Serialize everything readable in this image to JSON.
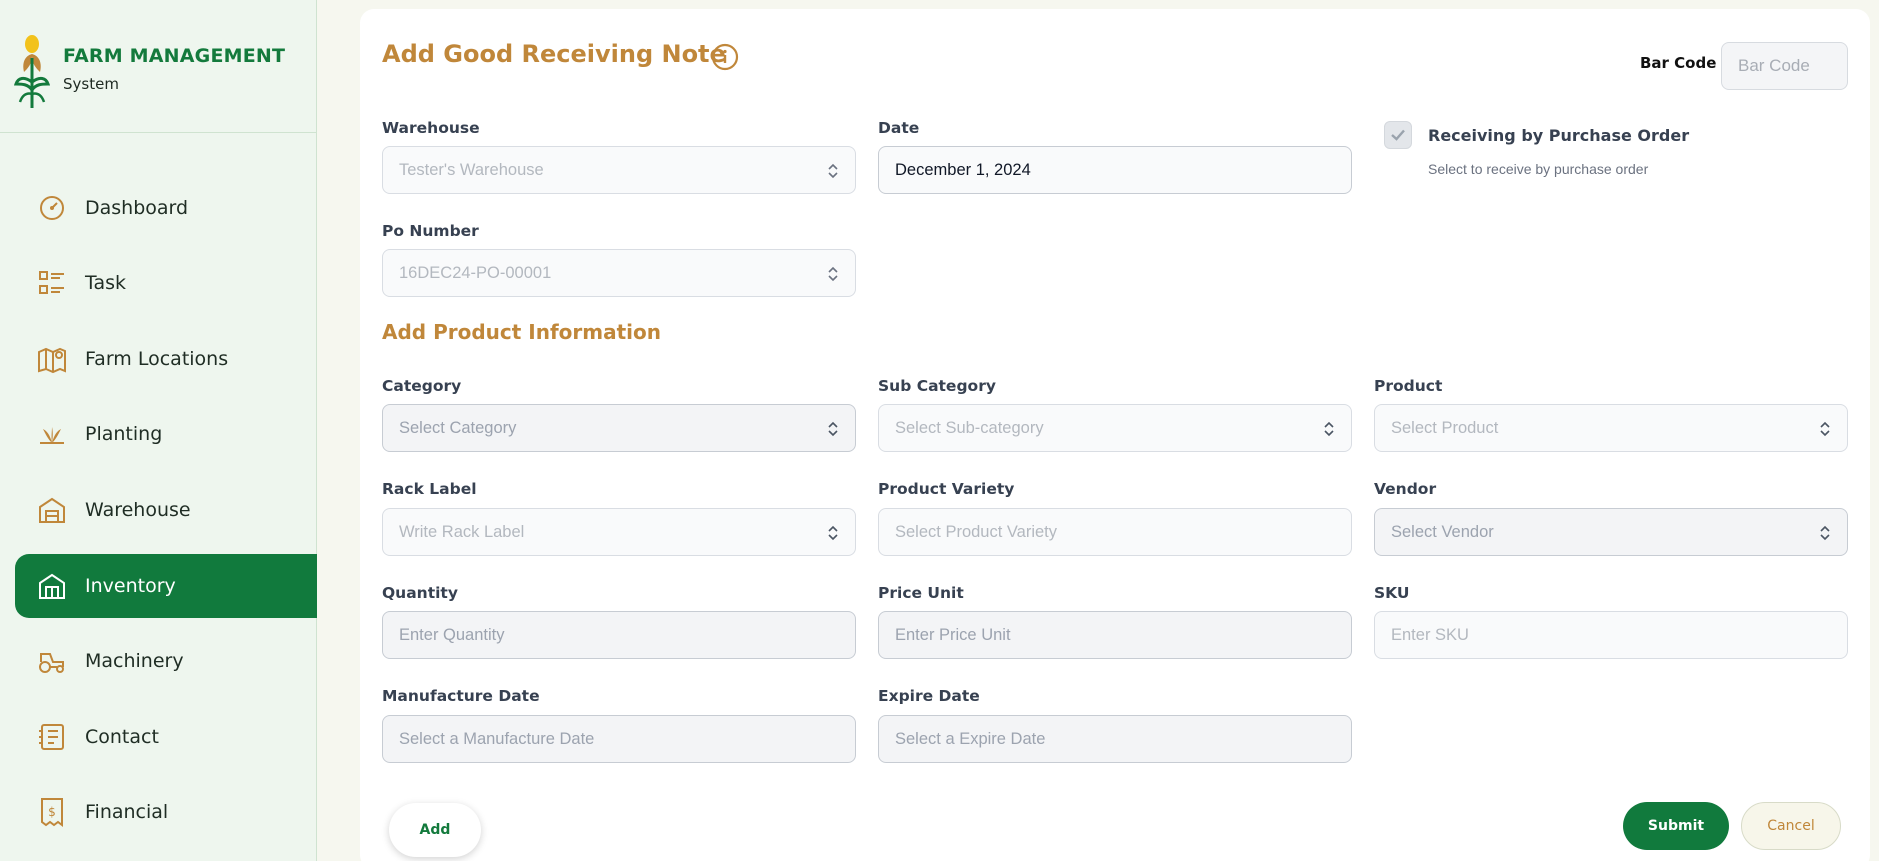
{
  "brand": {
    "title": "FARM MANAGEMENT",
    "subtitle": "System"
  },
  "sidebar": {
    "items": [
      {
        "label": "Dashboard",
        "icon": "dashboard-gauge-icon",
        "active": false
      },
      {
        "label": "Task",
        "icon": "task-list-icon",
        "active": false
      },
      {
        "label": "Farm Locations",
        "icon": "map-pin-icon",
        "active": false
      },
      {
        "label": "Planting",
        "icon": "plant-icon",
        "active": false
      },
      {
        "label": "Warehouse",
        "icon": "warehouse-icon",
        "active": false
      },
      {
        "label": "Inventory",
        "icon": "inventory-icon",
        "active": true
      },
      {
        "label": "Machinery",
        "icon": "tractor-icon",
        "active": false
      },
      {
        "label": "Contact",
        "icon": "contact-book-icon",
        "active": false
      },
      {
        "label": "Financial",
        "icon": "receipt-dollar-icon",
        "active": false
      }
    ]
  },
  "header": {
    "title": "Add Good Receiving Note",
    "barcode_label": "Bar Code",
    "barcode_placeholder": "Bar Code"
  },
  "form": {
    "warehouse": {
      "label": "Warehouse",
      "value": "Tester's Warehouse"
    },
    "date": {
      "label": "Date",
      "value": "December 1, 2024"
    },
    "receiving_po": {
      "label": "Receiving by Purchase Order",
      "hint": "Select to receive by purchase order",
      "checked": true
    },
    "po_number": {
      "label": "Po Number",
      "value": "16DEC24-PO-00001"
    }
  },
  "product_section": {
    "title": "Add Product Information",
    "category": {
      "label": "Category",
      "placeholder": "Select Category"
    },
    "sub_category": {
      "label": "Sub Category",
      "placeholder": "Select Sub-category"
    },
    "product": {
      "label": "Product",
      "placeholder": "Select Product"
    },
    "rack_label": {
      "label": "Rack Label",
      "placeholder": "Write Rack Label"
    },
    "product_variety": {
      "label": "Product Variety",
      "placeholder": "Select Product Variety"
    },
    "vendor": {
      "label": "Vendor",
      "placeholder": "Select Vendor"
    },
    "quantity": {
      "label": "Quantity",
      "placeholder": "Enter Quantity"
    },
    "price_unit": {
      "label": "Price Unit",
      "placeholder": "Enter Price Unit"
    },
    "sku": {
      "label": "SKU",
      "placeholder": "Enter SKU"
    },
    "manufacture_date": {
      "label": "Manufacture Date",
      "placeholder": "Select a Manufacture Date"
    },
    "expire_date": {
      "label": "Expire Date",
      "placeholder": "Select a Expire Date"
    }
  },
  "buttons": {
    "add": "Add",
    "submit": "Submit",
    "cancel": "Cancel"
  },
  "colors": {
    "primary_green": "#117a3d",
    "accent_gold": "#c0873a",
    "sidebar_bg": "#eef6ee"
  }
}
